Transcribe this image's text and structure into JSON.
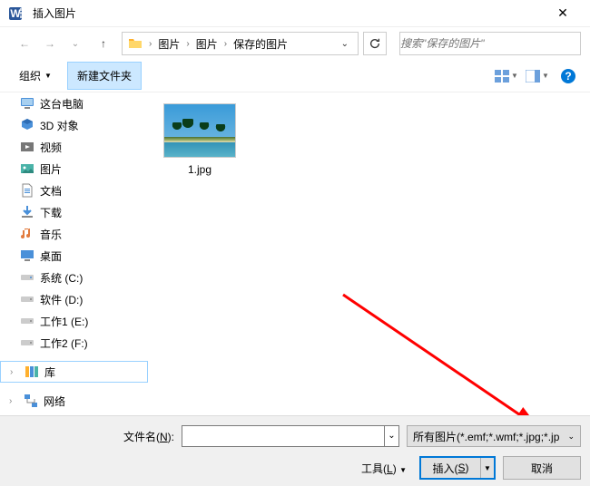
{
  "window": {
    "title": "插入图片"
  },
  "breadcrumb": {
    "items": [
      "图片",
      "图片",
      "保存的图片"
    ]
  },
  "search": {
    "placeholder": "搜索\"保存的图片\""
  },
  "toolbar": {
    "organize": "组织",
    "newfolder": "新建文件夹"
  },
  "sidebar": {
    "items": [
      {
        "icon": "pc",
        "label": "这台电脑"
      },
      {
        "icon": "3d",
        "label": "3D 对象"
      },
      {
        "icon": "video",
        "label": "视频"
      },
      {
        "icon": "pic",
        "label": "图片"
      },
      {
        "icon": "doc",
        "label": "文档"
      },
      {
        "icon": "download",
        "label": "下载"
      },
      {
        "icon": "music",
        "label": "音乐"
      },
      {
        "icon": "desktop",
        "label": "桌面"
      },
      {
        "icon": "drive",
        "label": "系统 (C:)"
      },
      {
        "icon": "drive",
        "label": "软件 (D:)"
      },
      {
        "icon": "drive",
        "label": "工作1 (E:)"
      },
      {
        "icon": "drive",
        "label": "工作2 (F:)"
      },
      {
        "icon": "lib",
        "label": "库",
        "group": true,
        "sel": true
      },
      {
        "icon": "net",
        "label": "网络",
        "group": true
      }
    ]
  },
  "files": [
    {
      "name": "1.jpg"
    }
  ],
  "footer": {
    "filename_label_pre": "文件名(",
    "filename_label_key": "N",
    "filename_label_post": "):",
    "filename_value": "",
    "filter": "所有图片(*.emf;*.wmf;*.jpg;*.jp",
    "tools_pre": "工具(",
    "tools_key": "L",
    "tools_post": ")",
    "open_pre": "插入(",
    "open_key": "S",
    "open_post": ")",
    "cancel": "取消"
  }
}
